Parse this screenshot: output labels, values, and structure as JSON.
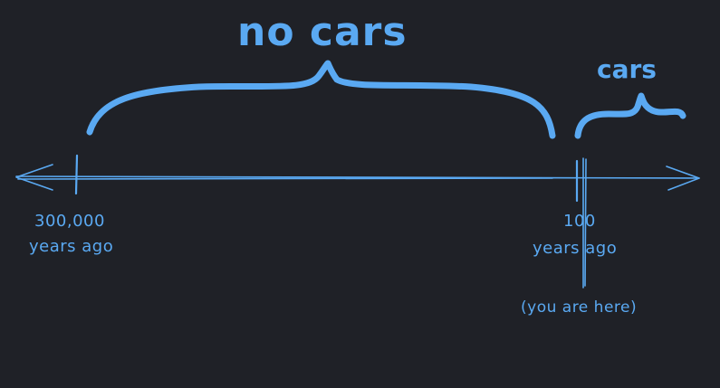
{
  "labels": {
    "no_cars": "no cars",
    "cars": "cars",
    "start_value": "300,000",
    "start_unit": "years ago",
    "end_value": "100",
    "end_unit": "years ago",
    "you_are_here": "(you are here)"
  },
  "colors": {
    "background": "#1f2127",
    "ink": "#5aa9f2"
  }
}
